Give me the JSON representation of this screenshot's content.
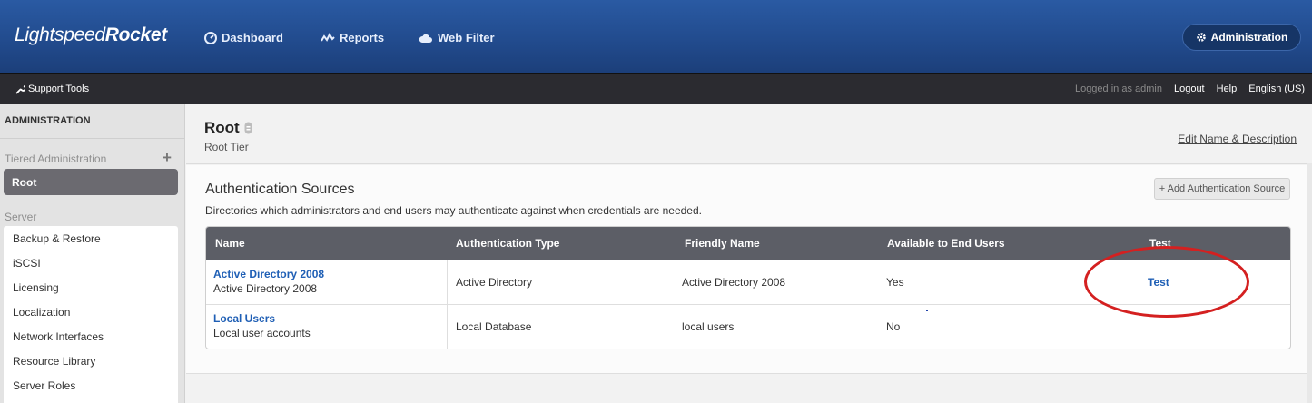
{
  "app": {
    "logo_light": "Lightspeed",
    "logo_bold": "Rocket"
  },
  "nav": {
    "dashboard": "Dashboard",
    "reports": "Reports",
    "web_filter": "Web Filter",
    "administration": "Administration"
  },
  "subbar": {
    "support_tools": "Support Tools",
    "logged_in": "Logged in as admin",
    "logout": "Logout",
    "help": "Help",
    "language": "English (US)"
  },
  "sidebar": {
    "title": "ADMINISTRATION",
    "tiered_label": "Tiered Administration",
    "root_item": "Root",
    "server_label": "Server",
    "server_items": [
      "Backup & Restore",
      "iSCSI",
      "Licensing",
      "Localization",
      "Network Interfaces",
      "Resource Library",
      "Server Roles"
    ]
  },
  "page": {
    "title": "Root",
    "subtitle": "Root Tier",
    "edit_link": "Edit Name & Description"
  },
  "auth": {
    "title": "Authentication Sources",
    "description": "Directories which administrators and end users may authenticate against when credentials are needed.",
    "add_button": "+ Add Authentication Source",
    "columns": [
      "Name",
      "Authentication Type",
      "Friendly Name",
      "Available to End Users",
      "Test"
    ],
    "rows": [
      {
        "name": "Active Directory 2008",
        "desc": "Active Directory 2008",
        "type": "Active Directory",
        "friendly": "Active Directory 2008",
        "available": "Yes",
        "test": "Test"
      },
      {
        "name": "Local Users",
        "desc": "Local user accounts",
        "type": "Local Database",
        "friendly": "local users",
        "available": "No",
        "test": ""
      }
    ]
  },
  "colors": {
    "header_blue": "#214a8c",
    "dark_bar": "#2b2b30",
    "link_blue": "#1f5fb5",
    "annotation_red": "#d42020"
  }
}
